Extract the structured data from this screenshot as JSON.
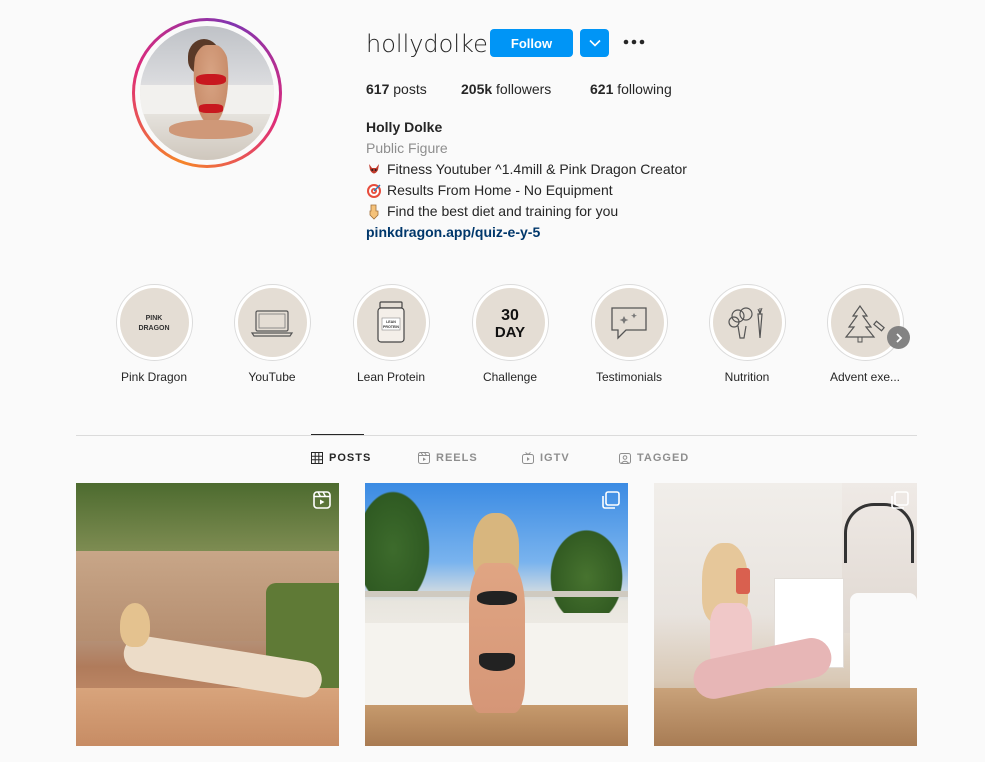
{
  "profile": {
    "username": "hollydolke",
    "follow_label": "Follow",
    "stats": {
      "posts_count": "617",
      "posts_label": "posts",
      "followers_count": "205k",
      "followers_label": "followers",
      "following_count": "621",
      "following_label": "following"
    },
    "bio": {
      "name": "Holly Dolke",
      "category": "Public Figure",
      "line1": "Fitness Youtuber ^1.4mill & Pink Dragon Creator",
      "line1_icon": "dragon-emoji",
      "line2": "Results From Home - No Equipment",
      "line2_icon": "target-emoji",
      "line3": "Find the best diet and training for you",
      "line3_icon": "pointing-down-emoji",
      "link": "pinkdragon.app/quiz-e-y-5"
    }
  },
  "highlights": [
    {
      "label": "Pink Dragon",
      "cover_text": "PINK\nDRAGON"
    },
    {
      "label": "YouTube",
      "cover_icon": "laptop-icon"
    },
    {
      "label": "Lean Protein",
      "cover_text": "LEAN\nPROTEIN"
    },
    {
      "label": "Challenge",
      "cover_text": "30\nDAY"
    },
    {
      "label": "Testimonials",
      "cover_icon": "speech-bubble-icon"
    },
    {
      "label": "Nutrition",
      "cover_icon": "vegetables-icon"
    },
    {
      "label": "Advent exe...",
      "cover_icon": "christmas-tree-icon"
    }
  ],
  "tabs": [
    {
      "label": "POSTS",
      "icon": "grid-icon",
      "active": true
    },
    {
      "label": "REELS",
      "icon": "reels-icon",
      "active": false
    },
    {
      "label": "IGTV",
      "icon": "igtv-icon",
      "active": false
    },
    {
      "label": "TAGGED",
      "icon": "tagged-icon",
      "active": false
    }
  ],
  "posts": [
    {
      "type": "reel",
      "icon": "reels-icon"
    },
    {
      "type": "carousel",
      "icon": "carousel-icon"
    },
    {
      "type": "carousel",
      "icon": "carousel-icon"
    }
  ],
  "colors": {
    "accent": "#0095f6",
    "link": "#00376b",
    "highlight_bg": "#e4ddd4"
  }
}
